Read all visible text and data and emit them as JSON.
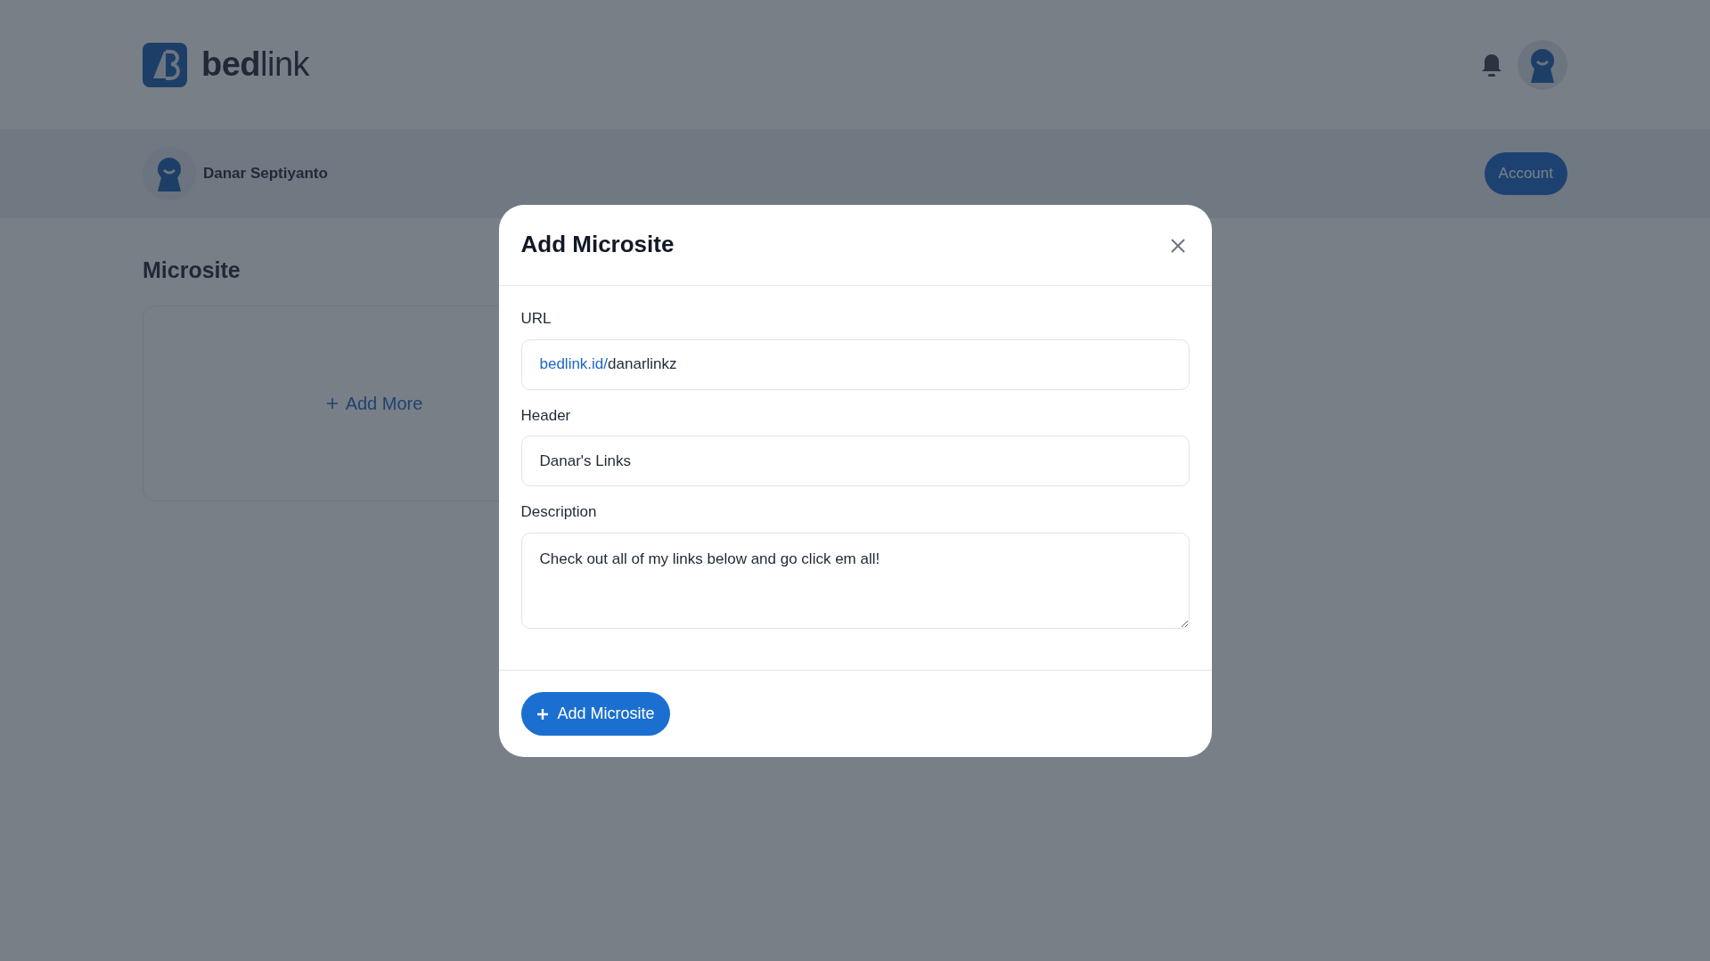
{
  "brand": {
    "name": "**bed**link"
  },
  "profile": {
    "name": "Danar Septiyanto",
    "button": "Account"
  },
  "section": {
    "title": "Microsite",
    "add_more": "Add More"
  },
  "modal": {
    "title": "Add Microsite",
    "fields": [
      {
        "kind": "url",
        "label": "URL",
        "prefix": "bedlink.id/",
        "value": "danarlinkz"
      },
      {
        "kind": "text",
        "label": "Header",
        "value": "Danar's Links"
      },
      {
        "kind": "textarea",
        "label": "Description",
        "value": "Check out all of my links below and go click em all!"
      }
    ],
    "submit": "Add Microsite"
  }
}
